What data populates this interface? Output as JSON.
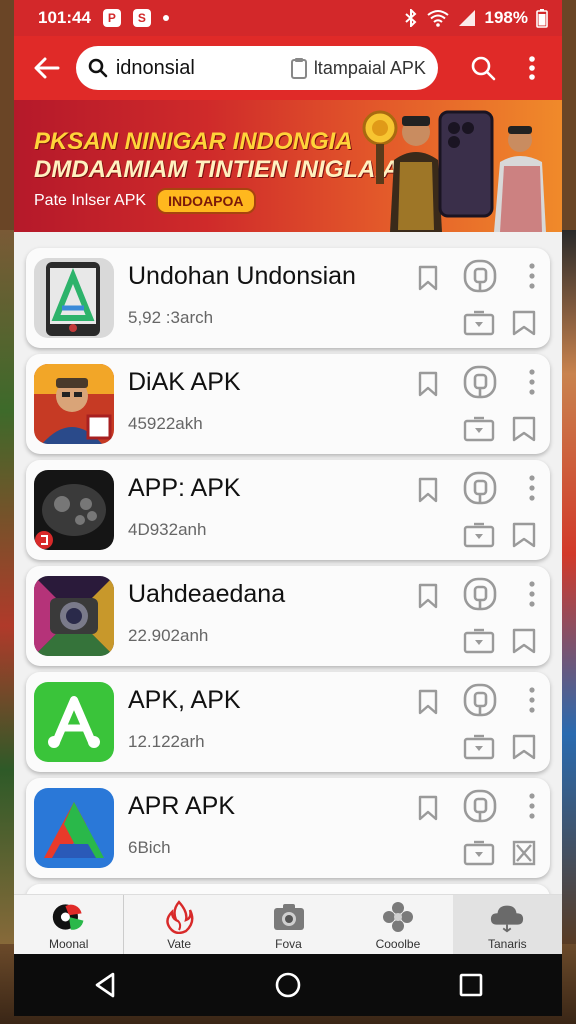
{
  "status_bar": {
    "time": "101:44",
    "app_icon_1": "P",
    "app_icon_2": "S",
    "battery": "198%"
  },
  "app_bar": {
    "search_value": "idnonsial",
    "search_sub_label": "ltampaial APK",
    "icons": [
      "back-arrow-icon",
      "search-icon",
      "more-vert-icon"
    ]
  },
  "banner": {
    "line1": "PKSAN NINIGAR INDONGIA",
    "line2": "DMDAAMIAM TINTIEN INIGLAIA",
    "sub": "Pate Inlser APK",
    "badge": "INDOAPOA"
  },
  "apps": [
    {
      "title": "Undohan Undonsian",
      "sub": "5,92 :3arch",
      "icon": "app-icon-a",
      "save_icon": "bookmark-icon"
    },
    {
      "title": "DiAK APK",
      "sub": "45922akh",
      "icon": "app-icon-portrait",
      "save_icon": "bookmark-icon"
    },
    {
      "title": "APP: APK",
      "sub": "4D932anh",
      "icon": "app-icon-gamepad",
      "save_icon": "bookmark-icon"
    },
    {
      "title": "Uahdeaedana",
      "sub": "22.902anh",
      "icon": "app-icon-camera",
      "save_icon": "bookmark-icon"
    },
    {
      "title": "APK, APK",
      "sub": "12.122arh",
      "icon": "app-icon-green-a",
      "save_icon": "bookmark-icon"
    },
    {
      "title": "APR APK",
      "sub": "6Bich",
      "icon": "app-icon-colorful-a",
      "save_icon": "close-box-icon"
    }
  ],
  "tabs": [
    {
      "label": "Moonal",
      "icon": "logo-icon"
    },
    {
      "label": "Vate",
      "icon": "flame-icon"
    },
    {
      "label": "Fova",
      "icon": "camera-icon"
    },
    {
      "label": "Cooolbe",
      "icon": "flower-icon"
    },
    {
      "label": "Tanaris",
      "icon": "cloud-icon"
    }
  ],
  "colors": {
    "primary_red": "#e02a28",
    "status_red": "#d3282a",
    "accent_yellow": "#ffd43a",
    "icon_gray": "#9a9a9a"
  }
}
